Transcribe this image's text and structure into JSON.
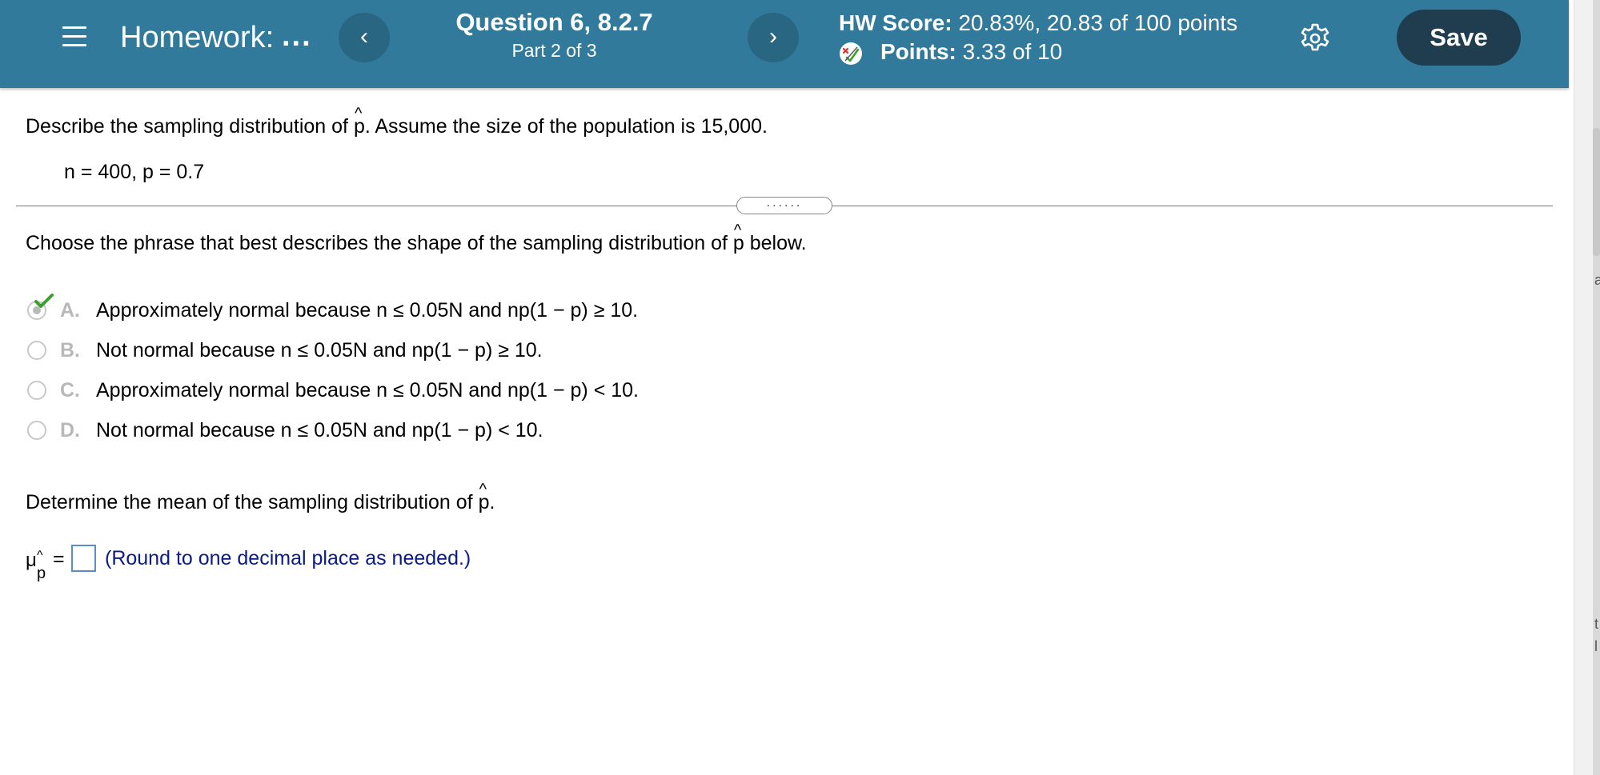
{
  "header": {
    "hw_title": "Homework:",
    "hw_more": "...",
    "question_title": "Question 6, 8.2.7",
    "question_part": "Part 2 of 3",
    "prev_label": "‹",
    "next_label": "›",
    "hw_score_label": "HW Score:",
    "hw_score_value": "20.83%, 20.83 of 100 points",
    "points_label": "Points:",
    "points_value": "3.33 of 10",
    "save_label": "Save"
  },
  "problem": {
    "prompt_before": "Describe the sampling distribution of ",
    "p_symbol": "p",
    "prompt_after": ". Assume the size of the population is 15,000.",
    "given": "n = 400, p = 0.7",
    "divider_dots": "......"
  },
  "part1": {
    "question_before": "Choose the phrase that best describes the shape of the sampling distribution of ",
    "p_symbol": "p",
    "question_after": " below.",
    "options": [
      {
        "letter": "A.",
        "text": "Approximately normal because n ≤ 0.05N and np(1 − p) ≥ 10.",
        "selected": true
      },
      {
        "letter": "B.",
        "text": "Not normal because n ≤ 0.05N and np(1 − p) ≥ 10.",
        "selected": false
      },
      {
        "letter": "C.",
        "text": "Approximately normal because n ≤ 0.05N and np(1 − p) < 10.",
        "selected": false
      },
      {
        "letter": "D.",
        "text": "Not normal because n ≤ 0.05N and np(1 − p) < 10.",
        "selected": false
      }
    ]
  },
  "part2": {
    "question_before": "Determine the mean of the sampling distribution of ",
    "p_symbol": "p",
    "question_after": ".",
    "mu_symbol": "μ",
    "mu_hat": "^",
    "mu_subscript": "p",
    "equals": "=",
    "answer_value": "",
    "hint": "(Round to one decimal place as needed.)"
  },
  "edge": {
    "letter_a": "a",
    "letter_t": "t",
    "letter_l": "l"
  },
  "colors": {
    "header_bg": "#327a9b",
    "nav_btn_bg": "#286682",
    "save_bg": "#1f3d4e",
    "hint_text": "#0b1b85",
    "check_green": "#3aa12f",
    "input_border": "#5b8ec9"
  }
}
